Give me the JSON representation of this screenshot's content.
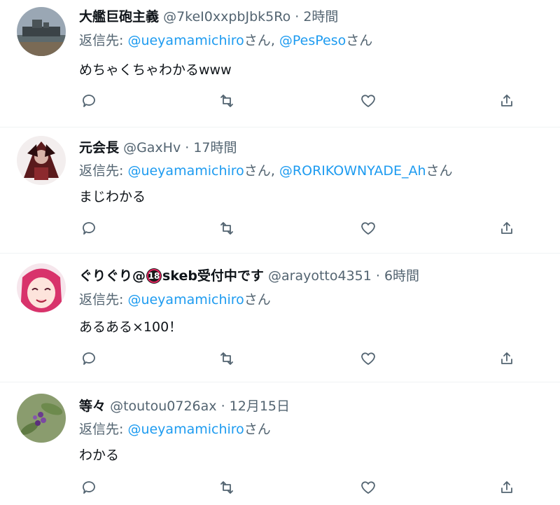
{
  "reply_prefix": "返信先: ",
  "san": "さん",
  "comma": ", ",
  "dot": " · ",
  "tweets": [
    {
      "name": "大艦巨砲主義",
      "handle": "@7keI0xxpbJbk5Ro",
      "time": "2時間",
      "mentions": [
        "@ueyamamichiro",
        "@PesPeso"
      ],
      "text": "めちゃくちゃわかるwww"
    },
    {
      "name": "元会長",
      "handle": "@GaxHv",
      "time": "17時間",
      "mentions": [
        "@ueyamamichiro",
        "@RORIKOWNYADE_Ah"
      ],
      "text": "まじわかる"
    },
    {
      "name_prefix": "ぐりぐり@",
      "name_badge": "18",
      "name_suffix": "skeb受付中です",
      "handle": "@arayotto4351",
      "time": "6時間",
      "mentions": [
        "@ueyamamichiro"
      ],
      "text": "あるある×100！"
    },
    {
      "name": "等々",
      "handle": "@toutou0726ax",
      "time": "12月15日",
      "mentions": [
        "@ueyamamichiro"
      ],
      "text": "わかる"
    }
  ],
  "actions": [
    "reply-icon",
    "retweet-icon",
    "like-icon",
    "share-icon"
  ],
  "colors": {
    "mention": "#1d9bf0",
    "secondary": "#536471",
    "text": "#0f1419",
    "divider": "#eff3f4"
  }
}
